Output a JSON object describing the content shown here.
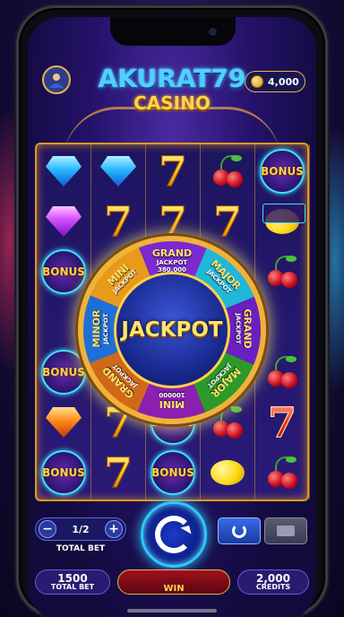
{
  "header": {
    "logo_title": "AKURAT79",
    "logo_subtitle": "CASINO",
    "credits_value": "4,000",
    "avatar_icon": "user-avatar-icon",
    "coin_icon": "gold-coin-icon"
  },
  "reels": [
    [
      "gem-blue",
      "gem-purple",
      "bonus",
      "",
      "bonus",
      "gem-orange",
      "bonus"
    ],
    [
      "gem-blue",
      "seven",
      "",
      "",
      "",
      "seven",
      "seven"
    ],
    [
      "seven",
      "seven",
      "",
      "",
      "",
      "bonus",
      "bonus"
    ],
    [
      "cherry",
      "seven",
      "",
      "",
      "",
      "cherry",
      "lemon"
    ],
    [
      "bonus",
      "lemon",
      "cherry",
      "",
      "cherry",
      "seven-red",
      "cherry"
    ]
  ],
  "symbols": {
    "bonus_label": "BONUS"
  },
  "wheel": {
    "center_label": "JACKPOT",
    "segments": [
      {
        "title": "GRAND",
        "sub": "JACKPOT 380,000"
      },
      {
        "title": "MAJOR",
        "sub": "JACKPOT"
      },
      {
        "title": "GRAND",
        "sub": "JACKPOT"
      },
      {
        "title": "MAJOR",
        "sub": "JACKPOT"
      },
      {
        "title": "MINI",
        "sub": "100000"
      },
      {
        "title": "GRAND",
        "sub": "JACKPOT"
      },
      {
        "title": "MINOR",
        "sub": "JACKPOT"
      },
      {
        "title": "MINI",
        "sub": "JACKPOT"
      }
    ]
  },
  "controls": {
    "bet_minus": "−",
    "bet_plus": "+",
    "bet_value": "1/2",
    "total_bet_label": "TOTAL BET",
    "spin_icon": "spin-arrow-icon",
    "refresh_icon": "refresh-icon",
    "auto_icon": "autoplay-icon"
  },
  "footer": {
    "total_bet_value": "1500",
    "total_bet_label": "TOTAL BET",
    "win_label": "WIN",
    "credits_value": "2,000",
    "credits_label": "CREDITS"
  },
  "colors": {
    "gold": "#e5b54a",
    "accent_blue": "#2ec8ff",
    "win_red": "#a0101e"
  }
}
